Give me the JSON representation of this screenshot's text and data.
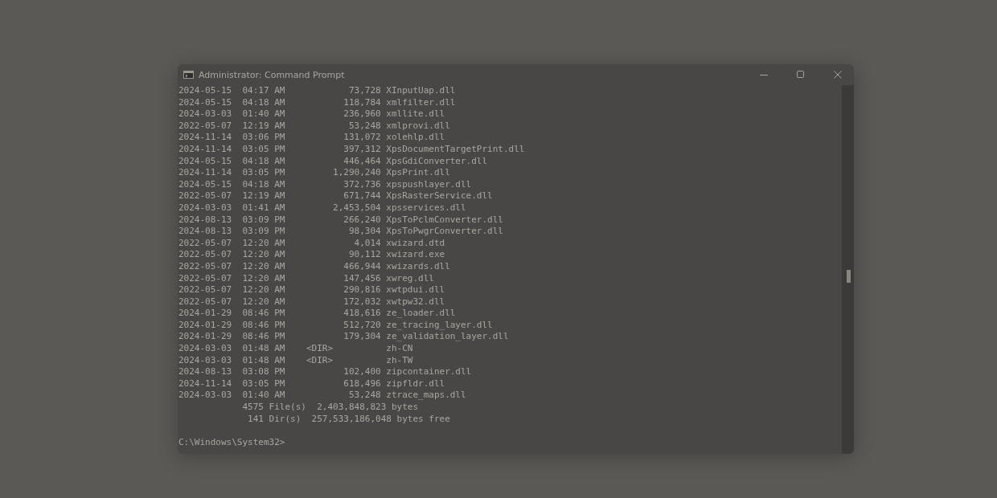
{
  "window": {
    "title": "Administrator: Command Prompt"
  },
  "output_lines": [
    "2024-05-15  04:17 AM            73,728 XInputUap.dll",
    "2024-05-15  04:18 AM           118,784 xmlfilter.dll",
    "2024-03-03  01:40 AM           236,960 xmllite.dll",
    "2022-05-07  12:19 AM            53,248 xmlprovi.dll",
    "2024-11-14  03:06 PM           131,072 xolehlp.dll",
    "2024-11-14  03:05 PM           397,312 XpsDocumentTargetPrint.dll",
    "2024-05-15  04:18 AM           446,464 XpsGdiConverter.dll",
    "2024-11-14  03:05 PM         1,290,240 XpsPrint.dll",
    "2024-05-15  04:18 AM           372,736 xpspushlayer.dll",
    "2022-05-07  12:19 AM           671,744 XpsRasterService.dll",
    "2024-03-03  01:41 AM         2,453,504 xpsservices.dll",
    "2024-08-13  03:09 PM           266,240 XpsToPclmConverter.dll",
    "2024-08-13  03:09 PM            98,304 XpsToPwgrConverter.dll",
    "2022-05-07  12:20 AM             4,014 xwizard.dtd",
    "2022-05-07  12:20 AM            90,112 xwizard.exe",
    "2022-05-07  12:20 AM           466,944 xwizards.dll",
    "2022-05-07  12:20 AM           147,456 xwreg.dll",
    "2022-05-07  12:20 AM           290,816 xwtpdui.dll",
    "2022-05-07  12:20 AM           172,032 xwtpw32.dll",
    "2024-01-29  08:46 PM           418,616 ze_loader.dll",
    "2024-01-29  08:46 PM           512,720 ze_tracing_layer.dll",
    "2024-01-29  08:46 PM           179,304 ze_validation_layer.dll",
    "2024-03-03  01:48 AM    <DIR>          zh-CN",
    "2024-03-03  01:48 AM    <DIR>          zh-TW",
    "2024-08-13  03:08 PM           102,400 zipcontainer.dll",
    "2024-11-14  03:05 PM           618,496 zipfldr.dll",
    "2024-03-03  01:40 AM            53,248 ztrace_maps.dll",
    "            4575 File(s)  2,403,848,823 bytes",
    "             141 Dir(s)  257,533,186,048 bytes free"
  ],
  "prompt": "C:\\Windows\\System32>"
}
